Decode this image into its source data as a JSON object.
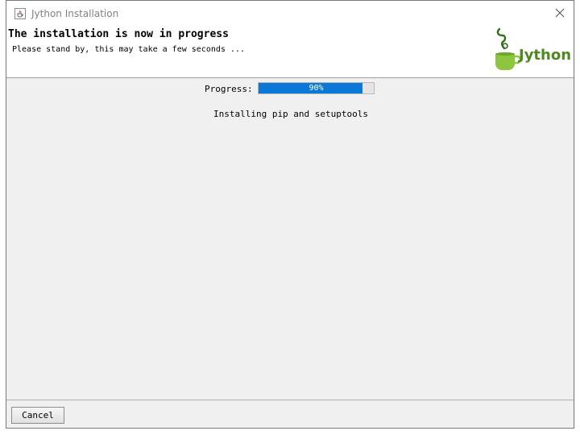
{
  "window": {
    "title": "Jython Installation",
    "close_icon": "close-icon",
    "app_icon": "java-cup-icon"
  },
  "header": {
    "title": "The installation is now in progress",
    "subtitle": "Please stand by, this may take a few seconds ...",
    "logo_text": "Jython",
    "logo_color": "#4e8a20"
  },
  "progress": {
    "label": "Progress:",
    "percent_text": "90%",
    "value": 0.9,
    "fill_color": "#0b78d7"
  },
  "status": {
    "message": "Installing pip and setuptools"
  },
  "footer": {
    "cancel_label": "Cancel"
  }
}
